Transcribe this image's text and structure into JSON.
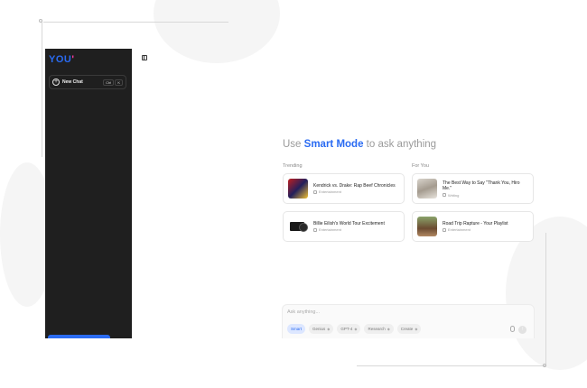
{
  "brand": {
    "logo_text": "YOU",
    "logo_mark": "'"
  },
  "sidebar": {
    "new_chat_label": "New Chat",
    "shortcut": [
      "Ctrl",
      "K"
    ]
  },
  "main": {
    "headline_prefix": "Use ",
    "headline_highlight": "Smart Mode",
    "headline_suffix": " to ask anything",
    "trending_label": "Trending",
    "for_you_label": "For You",
    "trending_cards": [
      {
        "title": "Kendrick vs. Drake: Rap Beef Chronicles",
        "tag": "Entertainment"
      },
      {
        "title": "Billie Eilish's World Tour Excitement",
        "tag": "Entertainment"
      }
    ],
    "for_you_cards": [
      {
        "title": "The Best Way to Say \"Thank You, Hiro Me.\"",
        "tag": "Writing"
      },
      {
        "title": "Road Trip Rapture - Your Playlist",
        "tag": "Entertainment"
      }
    ]
  },
  "input": {
    "placeholder": "Ask anything...",
    "modes": [
      "Smart",
      "Genius",
      "GPT-4",
      "Research",
      "Create"
    ],
    "active_mode": "Smart"
  },
  "colors": {
    "accent": "#2a6bf2",
    "sidebar_bg": "#1f1f1f"
  }
}
